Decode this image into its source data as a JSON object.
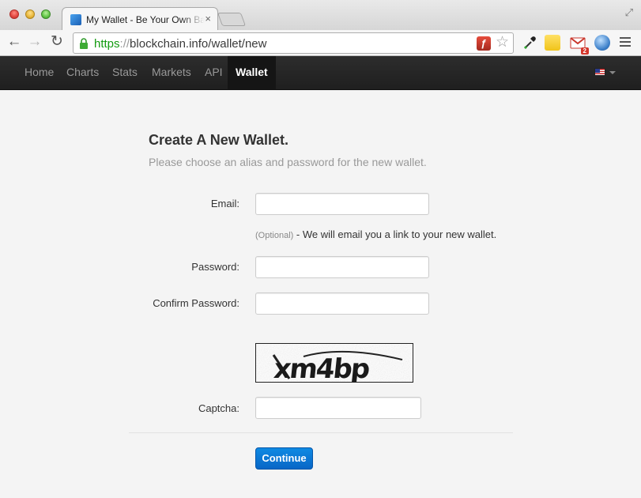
{
  "browser": {
    "tab_title": "My Wallet - Be Your Own Bank",
    "tab_close": "×",
    "url_scheme": "https",
    "url_sep": "://",
    "url_rest": "blockchain.info/wallet/new",
    "mail_badge": "2"
  },
  "nav": {
    "items": [
      "Home",
      "Charts",
      "Stats",
      "Markets",
      "API",
      "Wallet"
    ],
    "active": "Wallet"
  },
  "form": {
    "heading": "Create A New Wallet.",
    "subtitle": "Please choose an alias and password for the new wallet.",
    "email_label": "Email:",
    "email_value": "",
    "email_help_optional": "(Optional)",
    "email_help_text": " - We will email you a link to your new wallet.",
    "password_label": "Password:",
    "password_value": "",
    "confirm_label": "Confirm Password:",
    "confirm_value": "",
    "captcha_text": "xm4bp",
    "captcha_label": "Captcha:",
    "captcha_value": "",
    "continue_label": "Continue"
  },
  "colors": {
    "accent": "#0866c6",
    "navbar": "#222222",
    "secure_url": "#129b10"
  }
}
